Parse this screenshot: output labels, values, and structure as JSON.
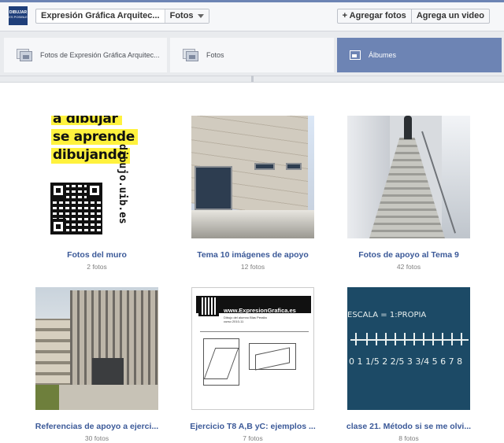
{
  "header": {
    "logo_text": "DIBUJAR",
    "logo_sub": "ES POSIBLE",
    "page_name": "Expresión Gráfica Arquitec...",
    "section": "Fotos",
    "add_photos_label": "+ Agregar fotos",
    "add_video_label": "Agrega un video"
  },
  "tabs": [
    {
      "label": "Fotos de Expresión Gráfica Arquitec...",
      "active": false
    },
    {
      "label": "Fotos",
      "active": false
    },
    {
      "label": "Álbumes",
      "active": true
    }
  ],
  "albums": [
    {
      "title": "Fotos del muro",
      "count": "2 fotos",
      "thumb_lines": [
        "a dibujar",
        "se aprende",
        "dibujando"
      ],
      "thumb_side": "dibujo.uib.es"
    },
    {
      "title": "Tema 10 imágenes de apoyo",
      "count": "12 fotos"
    },
    {
      "title": "Fotos de apoyo al Tema 9",
      "count": "42 fotos"
    },
    {
      "title": "Referencias de apoyo a ejerci...",
      "count": "30 fotos"
    },
    {
      "title": "Ejercicio T8 A,B yC: ejemplos ...",
      "count": "7 fotos",
      "thumb_url": "www.ExpresionGrafica.es",
      "thumb_sub": [
        "Dibujo del alumno Blas Peralta",
        "curso 2010-11"
      ]
    },
    {
      "title": "clase 21. Método si se me olvi...",
      "count": "8 fotos",
      "thumb_chalk_top": "ESCALA = 1:PROPIA",
      "thumb_chalk_numbers": "0 1 1/5 2 2/5 3 3/4 5 6 7 8"
    }
  ],
  "colors": {
    "brand": "#3b5998",
    "tab_active": "#6d84b4",
    "highlight": "#fff23d"
  }
}
